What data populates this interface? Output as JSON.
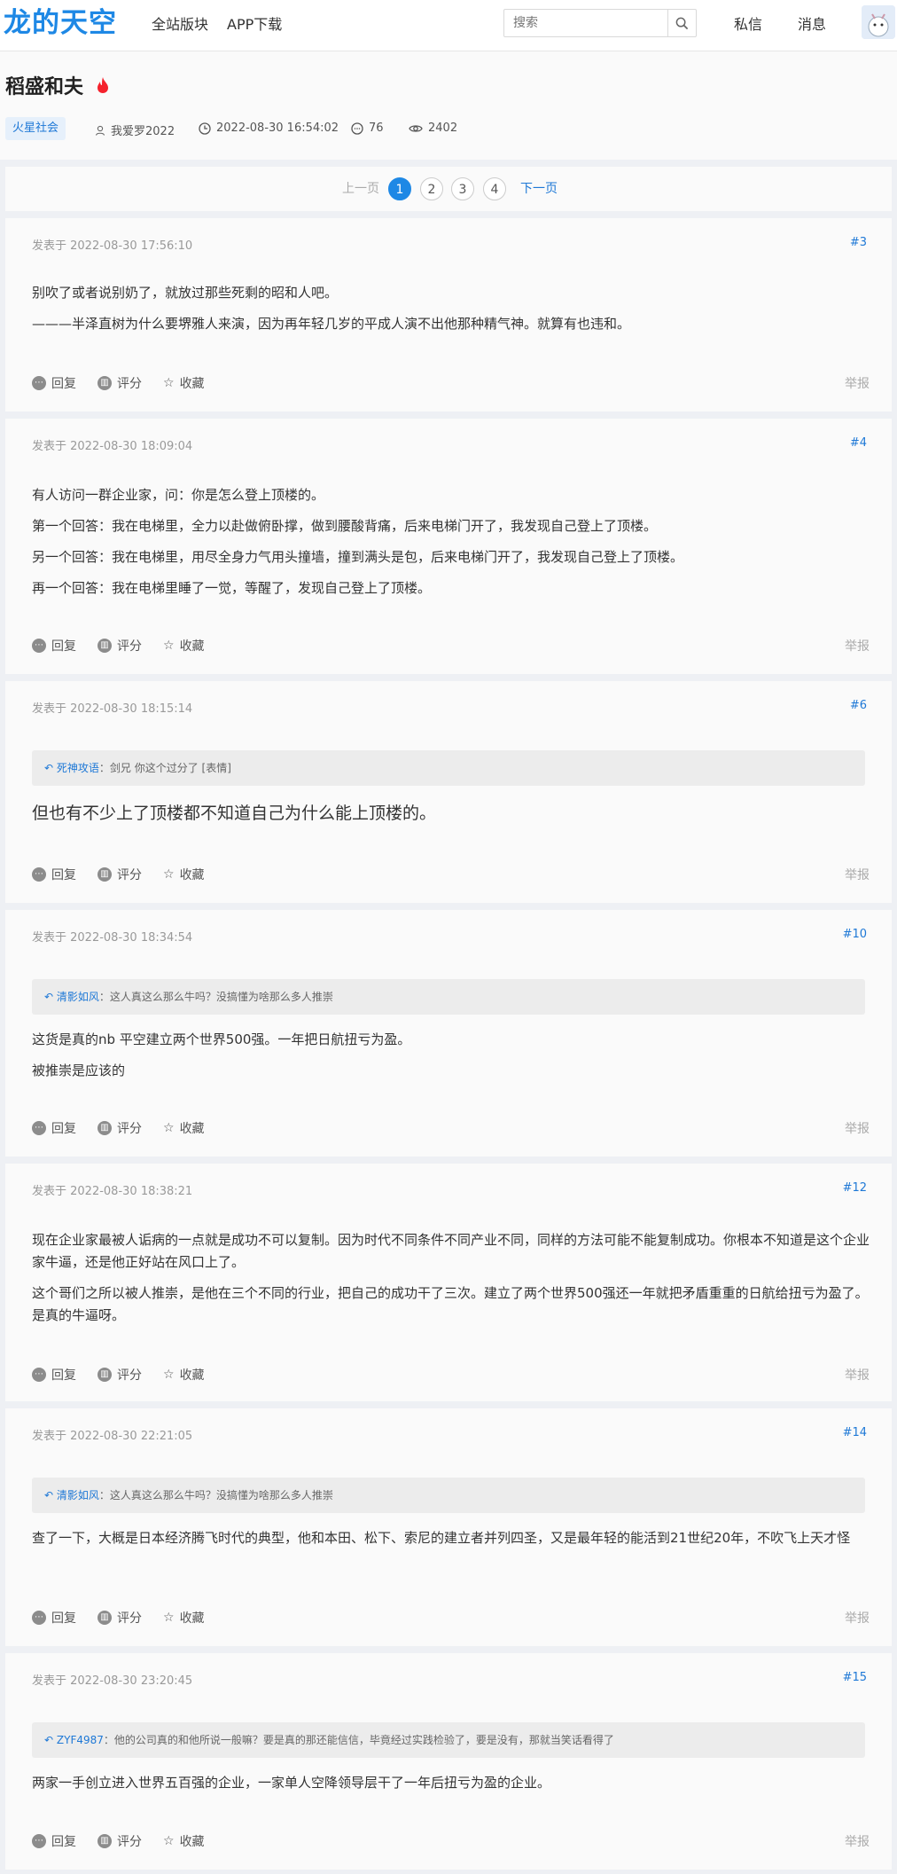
{
  "header": {
    "logo": "龙的天空",
    "nav": [
      "全站版块",
      "APP下载"
    ],
    "search_placeholder": "搜索",
    "messages": "私信",
    "notifications": "消息"
  },
  "thread": {
    "title": "稻盛和夫",
    "category": "火星社会",
    "author": "我爱罗2022",
    "datetime": "2022-08-30 16:54:02",
    "replies": "76",
    "views": "2402"
  },
  "pager": {
    "prev": "上一页",
    "pages": [
      "1",
      "2",
      "3",
      "4"
    ],
    "current": "1",
    "next": "下一页"
  },
  "actions": {
    "reply": "回复",
    "rate": "评分",
    "favorite": "收藏",
    "report": "举报"
  },
  "posts": [
    {
      "date": "发表于 2022-08-30 17:56:10",
      "floor": "#3",
      "paragraphs": [
        "别吹了或者说别奶了，就放过那些死剩的昭和人吧。",
        "———半泽直树为什么要堺雅人来演，因为再年轻几岁的平成人演不出他那种精气神。就算有也违和。"
      ]
    },
    {
      "date": "发表于 2022-08-30 18:09:04",
      "floor": "#4",
      "paragraphs": [
        "有人访问一群企业家，问：你是怎么登上顶楼的。",
        "第一个回答：我在电梯里，全力以赴做俯卧撑，做到腰酸背痛，后来电梯门开了，我发现自己登上了顶楼。",
        "另一个回答：我在电梯里，用尽全身力气用头撞墙，撞到满头是包，后来电梯门开了，我发现自己登上了顶楼。",
        "再一个回答：我在电梯里睡了一觉，等醒了，发现自己登上了顶楼。"
      ]
    },
    {
      "date": "发表于 2022-08-30 18:15:14",
      "floor": "#6",
      "quote_user": "死神攻语",
      "quote_text": "剑兄 你这个过分了 [表情]",
      "paragraphs": [
        "但也有不少上了顶楼都不知道自己为什么能上顶楼的。"
      ]
    },
    {
      "date": "发表于 2022-08-30 18:34:54",
      "floor": "#10",
      "quote_user": "清影如风",
      "quote_text": "这人真这么那么牛吗？没搞懂为啥那么多人推崇",
      "paragraphs": [
        "这货是真的nb 平空建立两个世界500强。一年把日航扭亏为盈。",
        "被推崇是应该的"
      ]
    },
    {
      "date": "发表于 2022-08-30 18:38:21",
      "floor": "#12",
      "paragraphs": [
        "现在企业家最被人诟病的一点就是成功不可以复制。因为时代不同条件不同产业不同，同样的方法可能不能复制成功。你根本不知道是这个企业家牛逼，还是他正好站在风口上了。",
        "这个哥们之所以被人推崇，是他在三个不同的行业，把自己的成功干了三次。建立了两个世界500强还一年就把矛盾重重的日航给扭亏为盈了。是真的牛逼呀。"
      ]
    },
    {
      "date": "发表于 2022-08-30 22:21:05",
      "floor": "#14",
      "quote_user": "清影如风",
      "quote_text": "这人真这么那么牛吗？没搞懂为啥那么多人推崇",
      "paragraphs": [
        "查了一下，大概是日本经济腾飞时代的典型，他和本田、松下、索尼的建立者并列四圣，又是最年轻的能活到21世纪20年，不吹飞上天才怪"
      ]
    },
    {
      "date": "发表于 2022-08-30 23:20:45",
      "floor": "#15",
      "quote_user": "ZYF4987",
      "quote_text": "他的公司真的和他所说一般嘛？要是真的那还能信信，毕竟经过实践检验了，要是没有，那就当笑话看得了",
      "paragraphs": [
        "两家一手创立进入世界五百强的企业，一家单人空降领导层干了一年后扭亏为盈的企业。"
      ]
    }
  ]
}
